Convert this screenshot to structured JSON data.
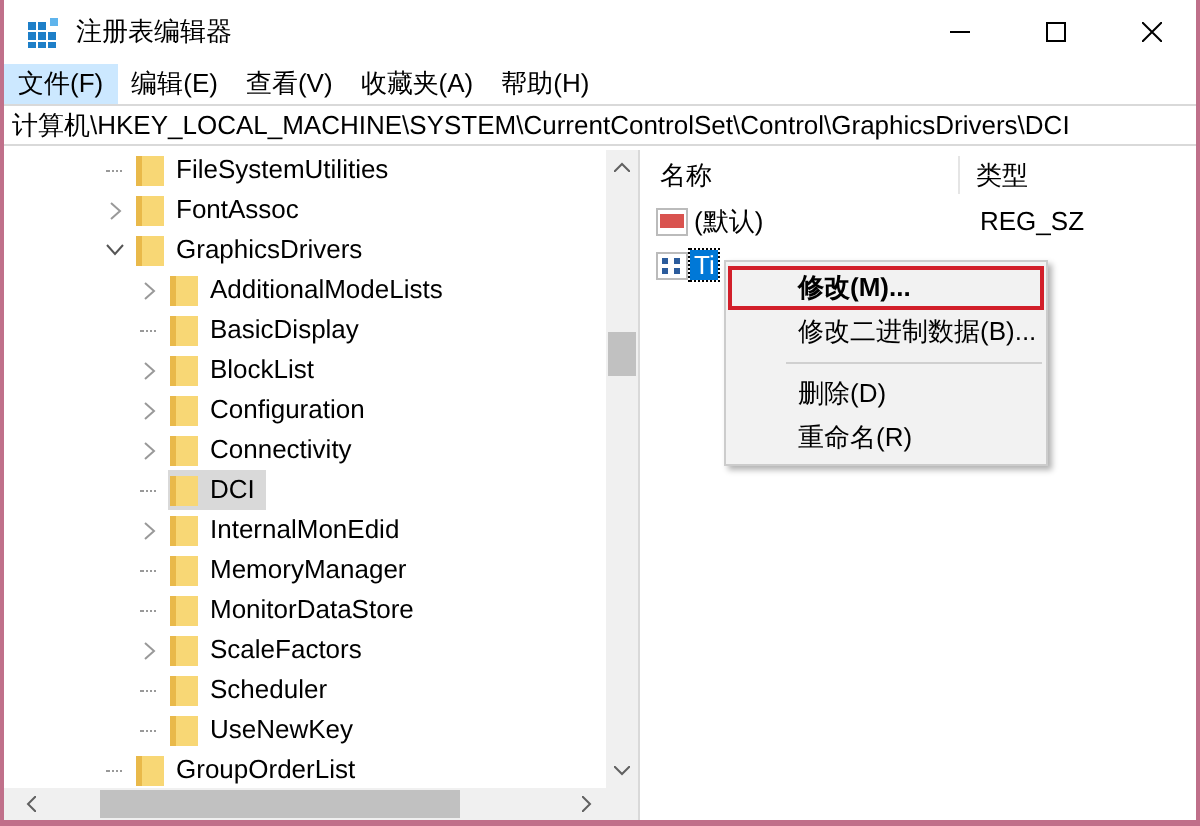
{
  "window": {
    "title": "注册表编辑器"
  },
  "menu": [
    {
      "label": "文件(F)",
      "selected": true
    },
    {
      "label": "编辑(E)",
      "selected": false
    },
    {
      "label": "查看(V)",
      "selected": false
    },
    {
      "label": "收藏夹(A)",
      "selected": false
    },
    {
      "label": "帮助(H)",
      "selected": false
    }
  ],
  "address": "计算机\\HKEY_LOCAL_MACHINE\\SYSTEM\\CurrentControlSet\\Control\\GraphicsDrivers\\DCI",
  "tree": [
    {
      "label": "FileSystemUtilities",
      "kind": "leaf",
      "selected": false
    },
    {
      "label": "FontAssoc",
      "kind": "collapsed",
      "selected": false
    },
    {
      "label": "GraphicsDrivers",
      "kind": "expanded",
      "selected": false,
      "children": [
        {
          "label": "AdditionalModeLists",
          "kind": "collapsed",
          "selected": false
        },
        {
          "label": "BasicDisplay",
          "kind": "leaf",
          "selected": false
        },
        {
          "label": "BlockList",
          "kind": "collapsed",
          "selected": false
        },
        {
          "label": "Configuration",
          "kind": "collapsed",
          "selected": false
        },
        {
          "label": "Connectivity",
          "kind": "collapsed",
          "selected": false
        },
        {
          "label": "DCI",
          "kind": "leaf",
          "selected": true
        },
        {
          "label": "InternalMonEdid",
          "kind": "collapsed",
          "selected": false
        },
        {
          "label": "MemoryManager",
          "kind": "leaf",
          "selected": false
        },
        {
          "label": "MonitorDataStore",
          "kind": "leaf",
          "selected": false
        },
        {
          "label": "ScaleFactors",
          "kind": "collapsed",
          "selected": false
        },
        {
          "label": "Scheduler",
          "kind": "leaf",
          "selected": false
        },
        {
          "label": "UseNewKey",
          "kind": "leaf",
          "selected": false
        }
      ]
    },
    {
      "label": "GroupOrderList",
      "kind": "leaf",
      "selected": false
    }
  ],
  "values": {
    "columns": [
      "名称",
      "类型"
    ],
    "rows": [
      {
        "kind": "string",
        "name": "(默认)",
        "type": "REG_SZ",
        "selected": false
      },
      {
        "kind": "dword",
        "name": "Ti",
        "selected": true
      }
    ]
  },
  "context_menu": [
    {
      "kind": "item",
      "label": "修改(M)...",
      "highlighted": true
    },
    {
      "kind": "item",
      "label": "修改二进制数据(B)...",
      "highlighted": false
    },
    {
      "kind": "separator"
    },
    {
      "kind": "item",
      "label": "删除(D)",
      "highlighted": false
    },
    {
      "kind": "item",
      "label": "重命名(R)",
      "highlighted": false
    }
  ]
}
